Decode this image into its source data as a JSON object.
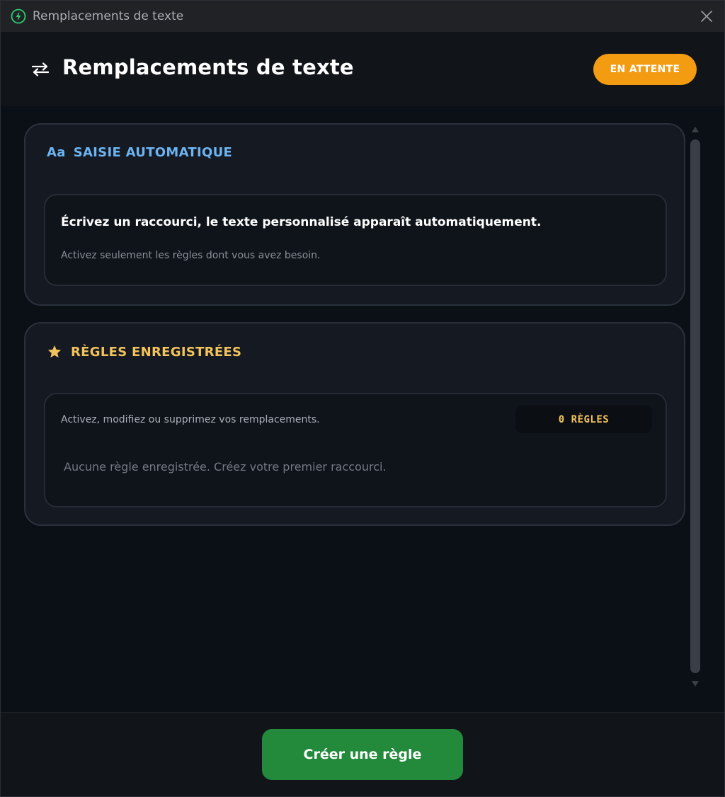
{
  "window": {
    "title": "Remplacements de texte"
  },
  "header": {
    "title": "Remplacements de texte",
    "status": "EN ATTENTE"
  },
  "auto_input": {
    "icon_label": "Aa",
    "title": "SAISIE AUTOMATIQUE",
    "headline": "Écrivez un raccourci, le texte personnalisé apparaît automatiquement.",
    "note": "Activez seulement les règles dont vous avez besoin."
  },
  "saved_rules": {
    "title": "RÈGLES ENREGISTRÉES",
    "description": "Activez, modifiez ou supprimez vos remplacements.",
    "count_label": "0 RÈGLES",
    "empty_message": "Aucune règle enregistrée. Créez votre premier raccourci."
  },
  "footer": {
    "create_label": "Créer une règle"
  },
  "colors": {
    "accent_status": "#f39c12",
    "accent_blue": "#6cb4f2",
    "accent_gold": "#f2c35a",
    "primary_button": "#238a3c",
    "app_icon": "#2ecc71"
  },
  "icons": {
    "app": "lightning-bolt-icon",
    "close": "close-icon",
    "swap": "swap-arrows-icon",
    "star": "star-icon"
  }
}
